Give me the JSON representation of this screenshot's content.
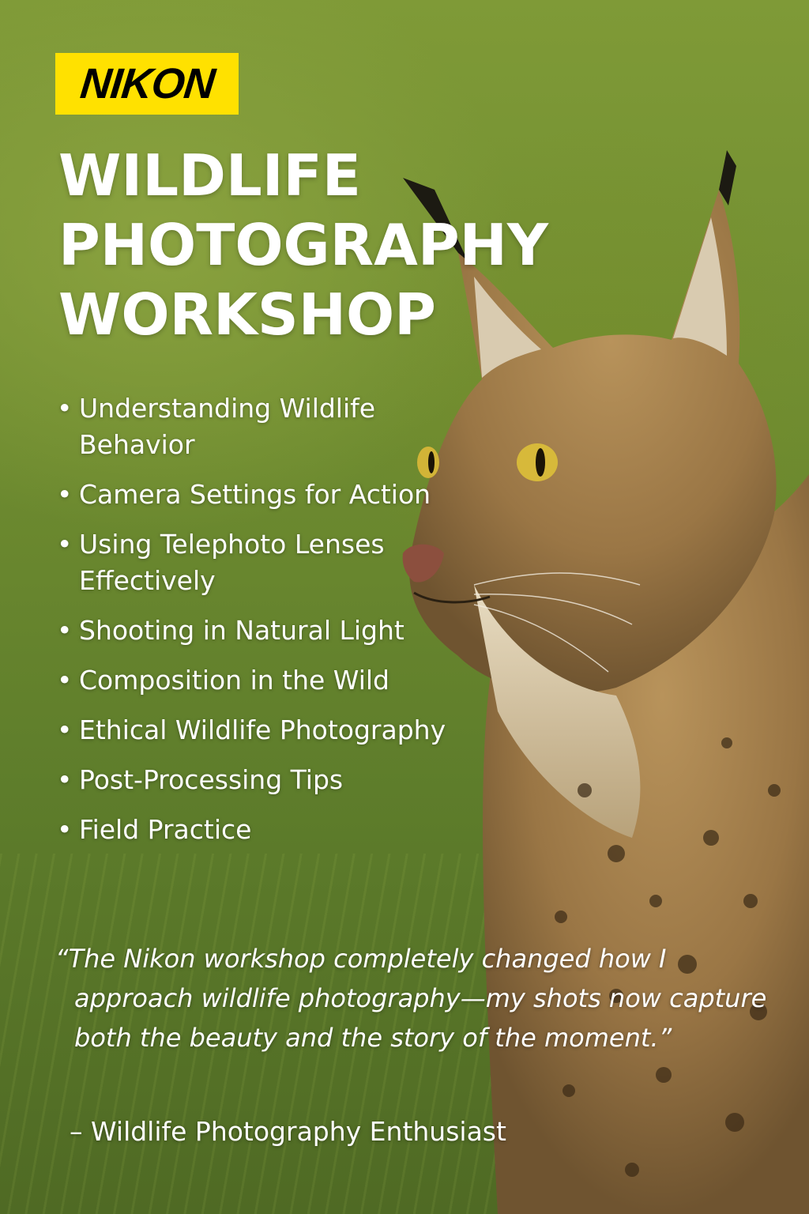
{
  "brand": {
    "logo_text": "NIKON",
    "logo_color": "#ffe100"
  },
  "title": {
    "line1": "WILDLIFE",
    "line2": "PHOTOGRAPHY",
    "line3": "WORKSHOP"
  },
  "topics": [
    "Understanding Wildlife Behavior",
    "Camera Settings for Action",
    "Using Telephoto Lenses Effectively",
    "Shooting in Natural Light",
    "Composition in the Wild",
    "Ethical Wildlife Photography",
    "Post-Processing Tips",
    "Field Practice"
  ],
  "testimonial": {
    "quote": "“The Nikon workshop completely changed how I approach wildlife photography—my shots now capture both the beauty and the story of the moment.”",
    "attribution": "– Wildlife Photography Enthusiast"
  },
  "colors": {
    "background": "#6f8c30",
    "text": "#ffffff",
    "lynx_fur": "#a8834f"
  }
}
